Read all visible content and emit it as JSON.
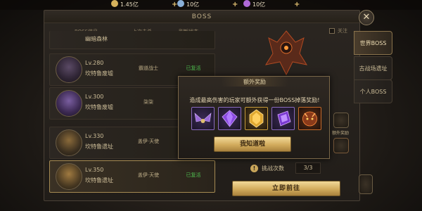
{
  "currency": {
    "gold": "1.45亿",
    "silver": "10亿",
    "diamond": "10亿",
    "colors": {
      "gold": "#d6b25c",
      "silver": "#8ab0d8",
      "diamond": "#b06ad8"
    }
  },
  "window": {
    "title": "BOSS"
  },
  "list": {
    "headers": {
      "info": "BOSS信息",
      "last_killer": "上次击杀",
      "refresh": "刷新状态"
    },
    "rows": [
      {
        "level": "",
        "name": "幽暗森林",
        "last_killer": "",
        "status": ""
      },
      {
        "level": "Lv.280",
        "name": "坎特鲁废墟",
        "last_killer": "霸道战士",
        "status": "已复活"
      },
      {
        "level": "Lv.300",
        "name": "坎特鲁废墟",
        "last_killer": "柒柒",
        "status": ""
      },
      {
        "level": "Lv.330",
        "name": "坎特鲁遗址",
        "last_killer": "盖伊·天使",
        "status": ""
      },
      {
        "level": "Lv.350",
        "name": "坎特鲁遗址",
        "last_killer": "盖伊·天使",
        "status": "已复活"
      }
    ]
  },
  "right": {
    "follow_label": "关注",
    "challenge_label": "挑战次数",
    "challenge_value": "3/3",
    "goto_label": "立即前往",
    "side_label": "额外奖励"
  },
  "tabs": [
    {
      "label": "世界BOSS",
      "active": true
    },
    {
      "label": "古战场遗址",
      "active": false
    },
    {
      "label": "个人BOSS",
      "active": false
    }
  ],
  "popup": {
    "title": "额外奖励",
    "message": "造成最高伤害的玩家可额外获得一份BOSS掉落奖励!",
    "confirm_label": "我知道啦",
    "rewards": [
      "wings-icon",
      "purple-gem-icon",
      "gold-gem-icon",
      "purple-crystal-icon",
      "beast-icon"
    ]
  }
}
